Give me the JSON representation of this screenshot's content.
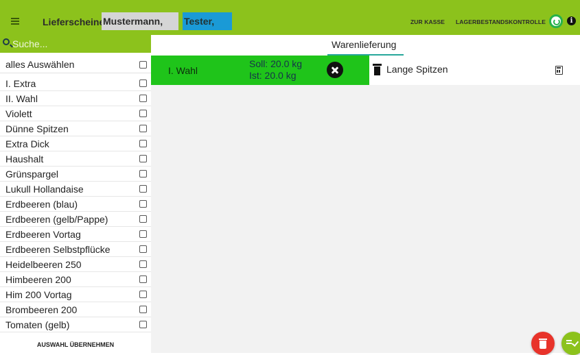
{
  "header": {
    "title": "Lieferscheine",
    "users": [
      "Mustermann, Max",
      "Tester, Tom"
    ],
    "nav": {
      "kasse": "ZUR KASSE",
      "lager": "LAGERBESTANDSKONTROLLE"
    },
    "info_glyph": "i",
    "icons": [
      "menu-icon",
      "sync-icon",
      "info-icon"
    ]
  },
  "search": {
    "placeholder": "Suche..."
  },
  "sidebar": {
    "select_all_label": "alles Auswählen",
    "items": [
      "I. Extra",
      "II. Wahl",
      "Violett",
      "Dünne Spitzen",
      "Extra Dick",
      "Haushalt",
      "Grünspargel",
      "Lukull Hollandaise",
      "Erdbeeren (blau)",
      "Erdbeeren (gelb/Pappe)",
      "Erdbeeren Vortag",
      "Erdbeeren Selbstpflücke",
      "Heidelbeeren 250",
      "Himbeeren 200",
      "Him 200 Vortag",
      "Brombeeren 200",
      "Tomaten (gelb)"
    ],
    "apply_label": "AUSWAHL ÜBERNEHMEN"
  },
  "main": {
    "tab": "Warenlieferung",
    "card": {
      "name": "I. Wahl",
      "soll": "Soll: 20.0 kg",
      "ist": "Ist: 20.0 kg"
    },
    "detail": {
      "name": "Lange Spitzen"
    }
  },
  "colors": {
    "accent": "#8cc21c",
    "card_green": "#1fc41a",
    "user_chip_blue": "#1a9ad6",
    "delete_red": "#e8332a",
    "tab_indicator": "#26a69a"
  }
}
